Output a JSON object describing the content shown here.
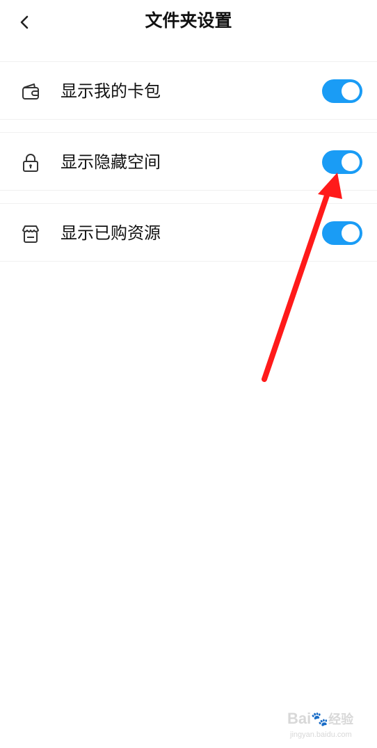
{
  "header": {
    "title": "文件夹设置"
  },
  "settings": [
    {
      "label": "显示我的卡包",
      "icon": "wallet-icon",
      "enabled": true
    },
    {
      "label": "显示隐藏空间",
      "icon": "lock-icon",
      "enabled": true
    },
    {
      "label": "显示已购资源",
      "icon": "store-icon",
      "enabled": true
    }
  ],
  "colors": {
    "toggle_on": "#1a9cf5",
    "annotation_arrow": "#ff1a1a"
  },
  "watermark": {
    "brand": "Bai",
    "brand_suffix": "经验",
    "url": "jingyan.baidu.com"
  }
}
